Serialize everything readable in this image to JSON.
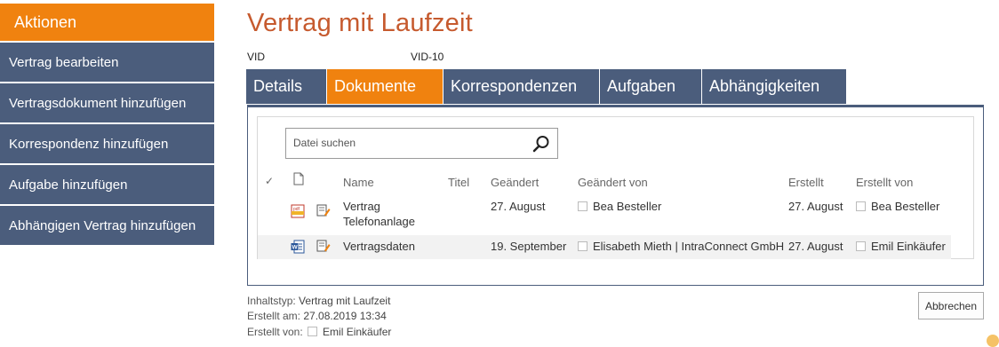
{
  "sidebar": {
    "header": "Aktionen",
    "items": [
      {
        "label": "Vertrag bearbeiten"
      },
      {
        "label": "Vertragsdokument hinzufügen"
      },
      {
        "label": "Korrespondenz hinzufügen"
      },
      {
        "label": "Aufgabe hinzufügen"
      },
      {
        "label": "Abhängigen Vertrag hinzufügen"
      }
    ]
  },
  "page": {
    "title": "Vertrag mit Laufzeit",
    "vid_label": "VID",
    "vid_value": "VID-10"
  },
  "tabs": [
    {
      "label": "Details",
      "active": false
    },
    {
      "label": "Dokumente",
      "active": true
    },
    {
      "label": "Korrespondenzen",
      "active": false
    },
    {
      "label": "Aufgaben",
      "active": false
    },
    {
      "label": "Abhängigkeiten",
      "active": false
    }
  ],
  "search": {
    "placeholder": "Datei suchen",
    "icon": "search-icon"
  },
  "table": {
    "check_header": "✓",
    "columns": [
      "Name",
      "Titel",
      "Geändert",
      "Geändert von",
      "Erstellt",
      "Erstellt von"
    ],
    "rows": [
      {
        "file_icon": "pdf-file-icon",
        "name_line1": "Vertrag",
        "name_line2": "Telefonanlage",
        "titel": "",
        "geaendert": "27. August",
        "geaendert_von": "Bea Besteller",
        "erstellt": "27. August",
        "erstellt_von": "Bea Besteller"
      },
      {
        "file_icon": "word-file-icon",
        "name_line1": "Vertragsdaten",
        "name_line2": "",
        "titel": "",
        "geaendert": "19. September",
        "geaendert_von": "Elisabeth Mieth | IntraConnect GmbH",
        "erstellt": "27. August",
        "erstellt_von": "Emil Einkäufer"
      }
    ]
  },
  "footer": {
    "inhaltstyp_label": "Inhaltstyp:",
    "inhaltstyp_value": "Vertrag mit Laufzeit",
    "erstellt_am_label": "Erstellt am:",
    "erstellt_am_value": "27.08.2019 13:34",
    "erstellt_von_label": "Erstellt von:",
    "erstellt_von_value": "Emil Einkäufer"
  },
  "actions": {
    "cancel_label": "Abbrechen"
  },
  "colors": {
    "accent": "#f0820f",
    "nav": "#4b5d7c",
    "title": "#c65a2e"
  }
}
